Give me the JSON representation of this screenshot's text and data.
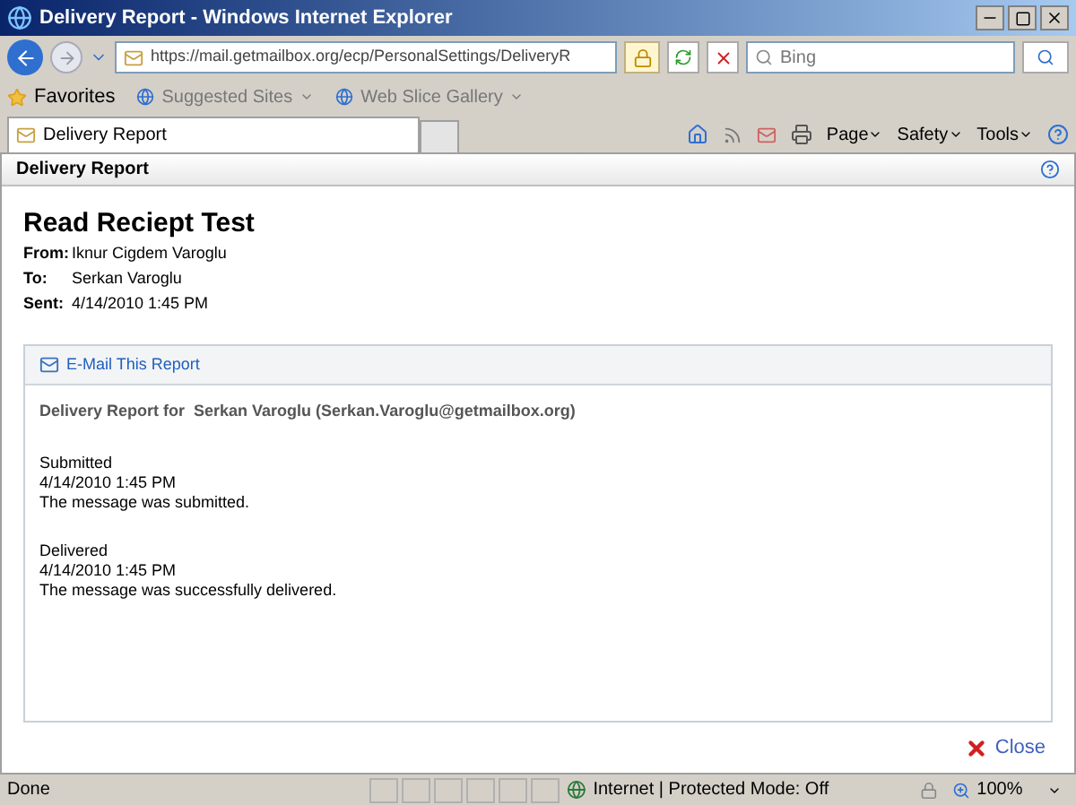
{
  "window": {
    "title": "Delivery Report - Windows Internet Explorer"
  },
  "address_bar": {
    "value": "https://mail.getmailbox.org/ecp/PersonalSettings/DeliveryR"
  },
  "search": {
    "placeholder": "Bing"
  },
  "favorites_bar": {
    "favorites": "Favorites",
    "links": [
      "Suggested Sites",
      "Web Slice Gallery"
    ]
  },
  "tab": {
    "title": "Delivery Report"
  },
  "command_bar": [
    "Page",
    "Safety",
    "Tools"
  ],
  "page_header": {
    "title": "Delivery Report"
  },
  "message": {
    "subject": "Read Reciept Test",
    "fields": [
      {
        "label": "From:",
        "value": "Iknur Cigdem Varoglu"
      },
      {
        "label": "To:",
        "value": "Serkan Varoglu"
      },
      {
        "label": "Sent:",
        "value": "4/14/2010 1:45 PM"
      }
    ]
  },
  "report": {
    "email_link": "E-Mail This Report",
    "heading": "Delivery Report for  Serkan Varoglu (Serkan.Varoglu@getmailbox.org)",
    "events": [
      {
        "status": "Submitted",
        "time": "4/14/2010 1:45 PM",
        "text": "The message was submitted."
      },
      {
        "status": "Delivered",
        "time": "4/14/2010 1:45 PM",
        "text": "The message was successfully delivered."
      }
    ]
  },
  "close_link": "Close",
  "status_bar": {
    "status": "Done",
    "zone": "Internet | Protected Mode: Off",
    "zoom": "100%"
  }
}
